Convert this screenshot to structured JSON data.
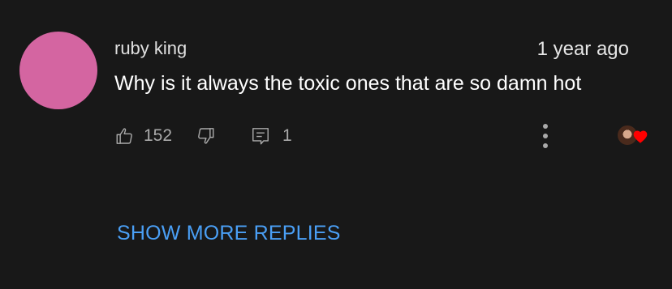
{
  "comment": {
    "author": "ruby king",
    "timestamp": "1 year ago",
    "text": "Why is it always the toxic ones that are so damn hot",
    "avatar_color": "#d465a1",
    "likes": "152",
    "replies": "1"
  },
  "icons": {
    "like": "thumbs-up-icon",
    "dislike": "thumbs-down-icon",
    "reply": "reply-icon",
    "more": "more-vertical-icon",
    "heart": "creator-heart-icon"
  },
  "show_more_label": "SHOW MORE REPLIES",
  "colors": {
    "background": "#181818",
    "link": "#4a9ff5",
    "heart": "#ff0000"
  }
}
